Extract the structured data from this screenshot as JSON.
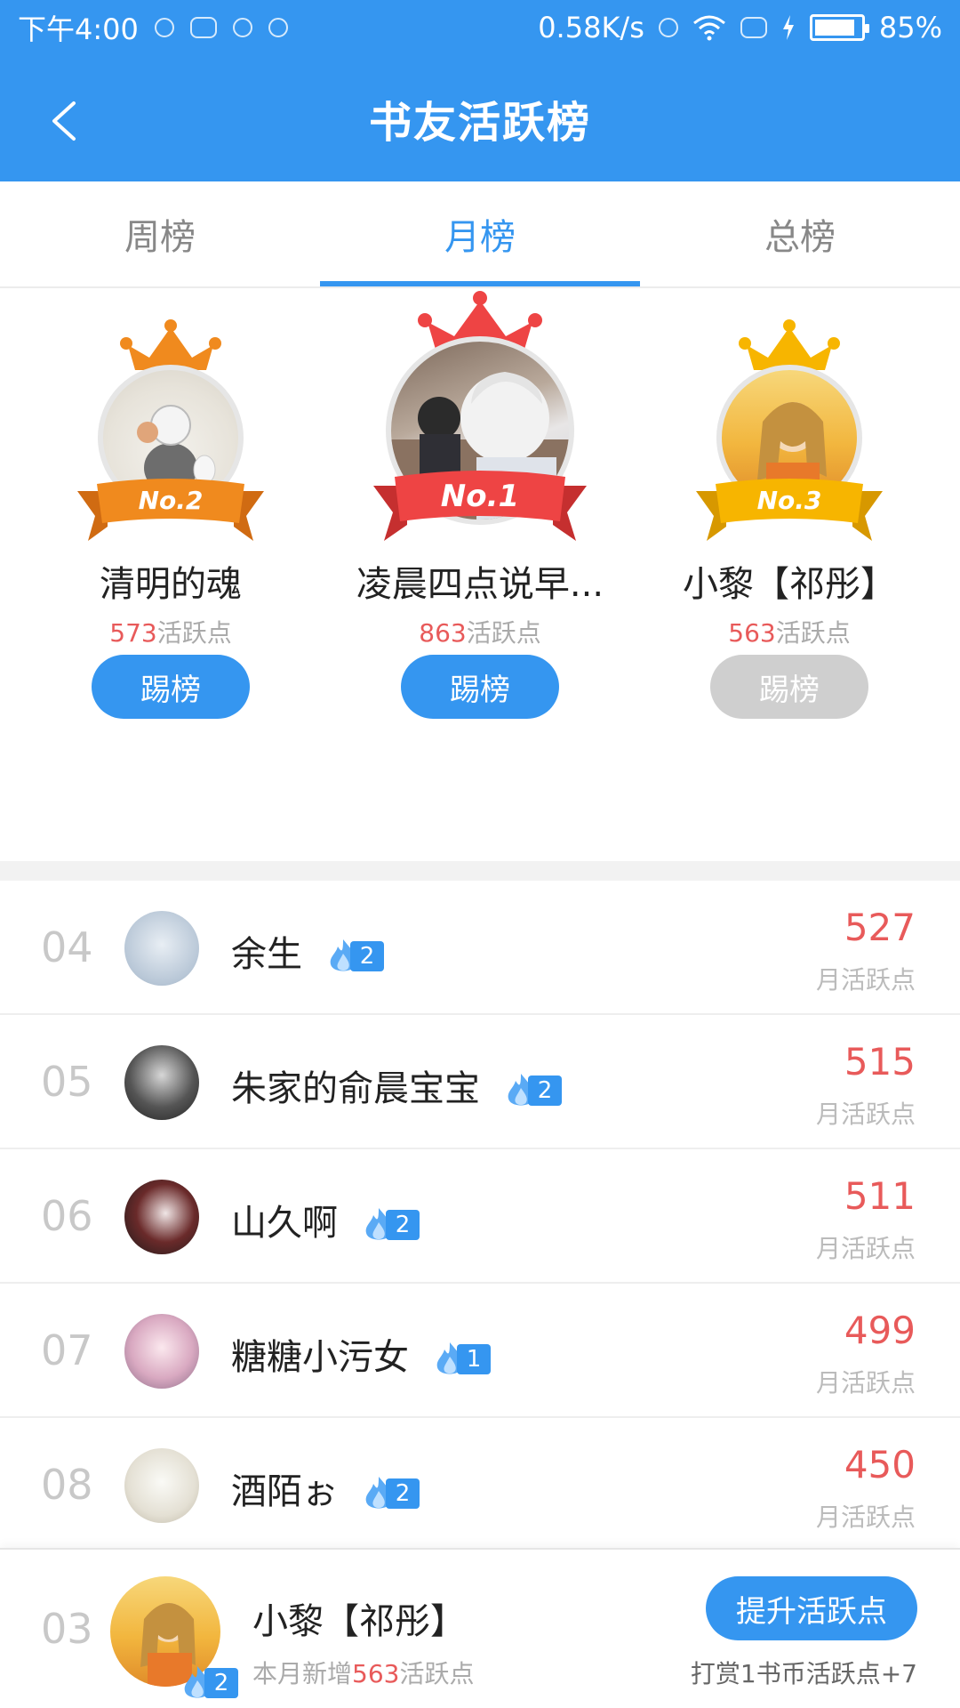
{
  "status_bar": {
    "time": "下午4:00",
    "network_speed": "0.58K/s",
    "battery": "85%"
  },
  "header": {
    "title": "书友活跃榜"
  },
  "tabs": [
    {
      "label": "周榜",
      "active": false
    },
    {
      "label": "月榜",
      "active": true
    },
    {
      "label": "总榜",
      "active": false
    }
  ],
  "podium": {
    "first": {
      "rank_label": "No.1",
      "name": "凌晨四点说早...",
      "points": "863",
      "points_unit": "活跃点",
      "button": "踢榜",
      "crown_color": "#ee4444"
    },
    "second": {
      "rank_label": "No.2",
      "name": "清明的魂",
      "points": "573",
      "points_unit": "活跃点",
      "button": "踢榜",
      "crown_color": "#f08a1e"
    },
    "third": {
      "rank_label": "No.3",
      "name": "小黎【祁彤】",
      "points": "563",
      "points_unit": "活跃点",
      "button": "踢榜",
      "crown_color": "#f7b500"
    }
  },
  "list": [
    {
      "rank": "04",
      "name": "余生",
      "level": "2",
      "score": "527",
      "unit": "月活跃点"
    },
    {
      "rank": "05",
      "name": "朱家的俞晨宝宝",
      "level": "2",
      "score": "515",
      "unit": "月活跃点"
    },
    {
      "rank": "06",
      "name": "山久啊",
      "level": "2",
      "score": "511",
      "unit": "月活跃点"
    },
    {
      "rank": "07",
      "name": "糖糖小污女",
      "level": "1",
      "score": "499",
      "unit": "月活跃点"
    },
    {
      "rank": "08",
      "name": "酒陌ぉ",
      "level": "2",
      "score": "450",
      "unit": "月活跃点"
    }
  ],
  "me": {
    "rank": "03",
    "name": "小黎【祁彤】",
    "level": "2",
    "sub_prefix": "本月新增",
    "sub_num": "563",
    "sub_suffix": "活跃点",
    "boost_button": "提升活跃点",
    "tip": "打赏1书币活跃点+7"
  },
  "colors": {
    "accent": "#3596f0",
    "score_red": "#e85a5a"
  }
}
